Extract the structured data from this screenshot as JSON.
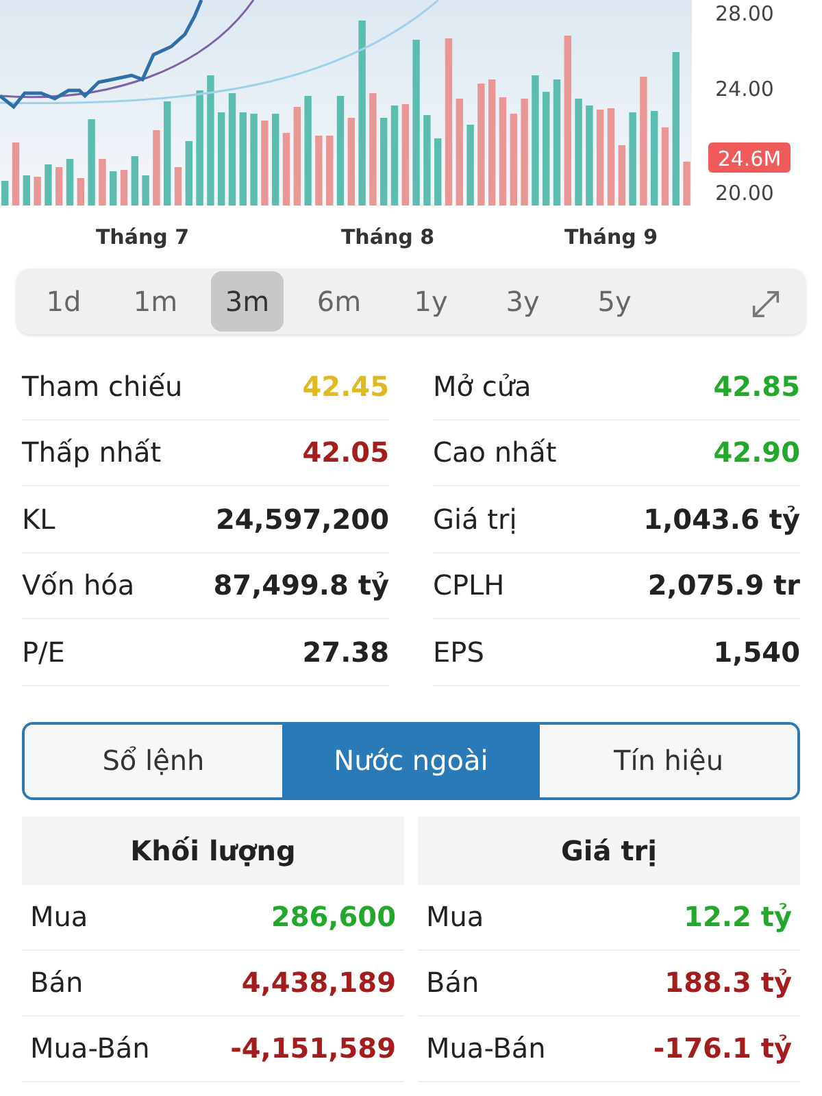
{
  "chart": {
    "y_labels": [
      "28.00",
      "24.00",
      "20.00"
    ],
    "volume_tag": "24.6M",
    "x_labels": [
      "Tháng 7",
      "Tháng 8",
      "Tháng 9"
    ]
  },
  "ranges": [
    {
      "label": "1d",
      "selected": false
    },
    {
      "label": "1m",
      "selected": false
    },
    {
      "label": "3m",
      "selected": true
    },
    {
      "label": "6m",
      "selected": false
    },
    {
      "label": "1y",
      "selected": false
    },
    {
      "label": "3y",
      "selected": false
    },
    {
      "label": "5y",
      "selected": false
    }
  ],
  "stats": [
    {
      "label": "Tham chiếu",
      "value": "42.45",
      "color": "#e0b820"
    },
    {
      "label": "Mở cửa",
      "value": "42.85",
      "color": "#22a82a"
    },
    {
      "label": "Thấp nhất",
      "value": "42.05",
      "color": "#a51c1c"
    },
    {
      "label": "Cao nhất",
      "value": "42.90",
      "color": "#22a82a"
    },
    {
      "label": "KL",
      "value": "24,597,200",
      "color": "#222222"
    },
    {
      "label": "Giá trị",
      "value": "1,043.6 tỷ",
      "color": "#222222"
    },
    {
      "label": "Vốn hóa",
      "value": "87,499.8 tỷ",
      "color": "#222222"
    },
    {
      "label": "CPLH",
      "value": "2,075.9 tr",
      "color": "#222222"
    },
    {
      "label": "P/E",
      "value": "27.38",
      "color": "#222222"
    },
    {
      "label": "EPS",
      "value": "1,540",
      "color": "#222222"
    }
  ],
  "tabs": [
    {
      "label": "Sổ lệnh",
      "selected": false
    },
    {
      "label": "Nước ngoài",
      "selected": true
    },
    {
      "label": "Tín hiệu",
      "selected": false
    }
  ],
  "tables": [
    {
      "title": "Khối lượng",
      "rows": [
        {
          "label": "Mua",
          "value": "286,600",
          "color": "#22a82a"
        },
        {
          "label": "Bán",
          "value": "4,438,189",
          "color": "#a51c1c"
        },
        {
          "label": "Mua-Bán",
          "value": "-4,151,589",
          "color": "#a51c1c"
        }
      ]
    },
    {
      "title": "Giá trị",
      "rows": [
        {
          "label": "Mua",
          "value": "12.2 tỷ",
          "color": "#22a82a"
        },
        {
          "label": "Bán",
          "value": "188.3 tỷ",
          "color": "#a51c1c"
        },
        {
          "label": "Mua-Bán",
          "value": "-176.1 tỷ",
          "color": "#a51c1c"
        }
      ]
    }
  ]
}
